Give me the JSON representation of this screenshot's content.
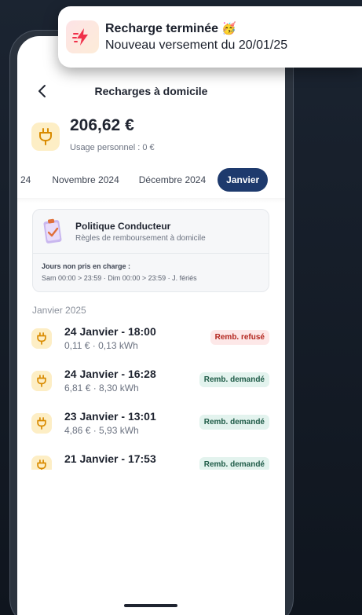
{
  "notification": {
    "title": "Recharge terminée",
    "emoji": "🥳",
    "body": "Nouveau versement du 20/01/25",
    "icon": "lightning-bolt-icon"
  },
  "header": {
    "title": "Recharges à domicile",
    "back_icon": "chevron-left-icon"
  },
  "summary": {
    "amount": "206,62 €",
    "usage": "Usage personnel : 0 €",
    "icon": "plug-icon"
  },
  "tabs": [
    {
      "label": "24",
      "active": false
    },
    {
      "label": "Novembre 2024",
      "active": false
    },
    {
      "label": "Décembre 2024",
      "active": false
    },
    {
      "label": "Janvier",
      "active": true
    }
  ],
  "policy": {
    "title": "Politique Conducteur",
    "subtitle": "Règles de remboursement à domicile",
    "days_label": "Jours non pris en charge :",
    "days": "Sam 00:00 > 23:59 · Dim 00:00 > 23:59 · J. fériés",
    "icon": "clipboard-check-icon"
  },
  "month_label": "Janvier 2025",
  "sessions": [
    {
      "title": "24 Janvier - 18:00",
      "detail": "0,11 € · 0,13 kWh",
      "status": "Remb. refusé",
      "status_type": "refused"
    },
    {
      "title": "24 Janvier - 16:28",
      "detail": "6,81 € · 8,30 kWh",
      "status": "Remb. demandé",
      "status_type": "requested"
    },
    {
      "title": "23 Janvier - 13:01",
      "detail": "4,86 € · 5,93 kWh",
      "status": "Remb. demandé",
      "status_type": "requested"
    },
    {
      "title": "21 Janvier - 17:53",
      "detail": "",
      "status": "Remb. demandé",
      "status_type": "requested"
    }
  ],
  "colors": {
    "accent": "#1e3a6d",
    "plug_badge": "#fdeec5",
    "refused_bg": "#fde8e8",
    "refused_text": "#b3261e",
    "requested_bg": "#e3f3ee",
    "requested_text": "#1e5b47"
  }
}
